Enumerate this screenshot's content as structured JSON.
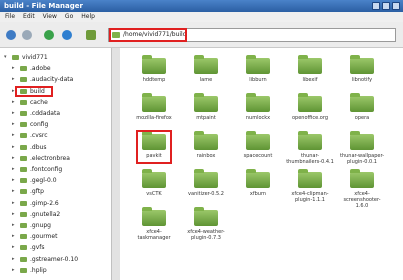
{
  "window": {
    "title": "build - File Manager"
  },
  "menubar": [
    "File",
    "Edit",
    "View",
    "Go",
    "Help"
  ],
  "address": {
    "path": "/home/vivid771/build"
  },
  "sidebar": {
    "items": [
      {
        "label": "vivid771",
        "depth": 0,
        "expanded": true
      },
      {
        "label": ".adobe",
        "depth": 1
      },
      {
        "label": ".audacity-data",
        "depth": 1
      },
      {
        "label": "build",
        "depth": 1,
        "selected": true
      },
      {
        "label": "cache",
        "depth": 1
      },
      {
        "label": ".cddadata",
        "depth": 1
      },
      {
        "label": "config",
        "depth": 1
      },
      {
        "label": ".cvsrc",
        "depth": 1
      },
      {
        "label": ".dbus",
        "depth": 1
      },
      {
        "label": ".electronbrea",
        "depth": 1
      },
      {
        "label": ".fontconfig",
        "depth": 1
      },
      {
        "label": ".gegl-0.0",
        "depth": 1
      },
      {
        "label": ".gftp",
        "depth": 1
      },
      {
        "label": ".gimp-2.6",
        "depth": 1
      },
      {
        "label": ".gnutella2",
        "depth": 1
      },
      {
        "label": ".gnupg",
        "depth": 1
      },
      {
        "label": ".gourmet",
        "depth": 1
      },
      {
        "label": ".gvfs",
        "depth": 1
      },
      {
        "label": ".gstreamer-0.10",
        "depth": 1
      },
      {
        "label": ".hplip",
        "depth": 1
      }
    ]
  },
  "files": [
    {
      "label": "hddtemp"
    },
    {
      "label": "lame"
    },
    {
      "label": "libburn"
    },
    {
      "label": "libexif"
    },
    {
      "label": "libnotify"
    },
    {
      "label": "mozilla-firefox"
    },
    {
      "label": "mtpaint"
    },
    {
      "label": "numlockx"
    },
    {
      "label": "openoffice.org"
    },
    {
      "label": "opera"
    },
    {
      "label": "pavkit",
      "highlighted": true
    },
    {
      "label": "rainbox"
    },
    {
      "label": "spacecount"
    },
    {
      "label": "thunar-thumbnailers-0.4.1"
    },
    {
      "label": "thunar-wallpaper-plugin-0.0.1"
    },
    {
      "label": "vsCTK"
    },
    {
      "label": "vanitizer-0.5.2"
    },
    {
      "label": "xfburn"
    },
    {
      "label": "xfce4-clipman-plugin-1.1.1"
    },
    {
      "label": "xfce4-screenshooter-1.6.0"
    },
    {
      "label": "xfce4-taskmanager"
    },
    {
      "label": "xfce4-weather-plugin-0.7.3"
    }
  ],
  "colors": {
    "folder": "#7fb24a",
    "highlight": "#e02020",
    "titlebar": "#2b5fa3"
  }
}
